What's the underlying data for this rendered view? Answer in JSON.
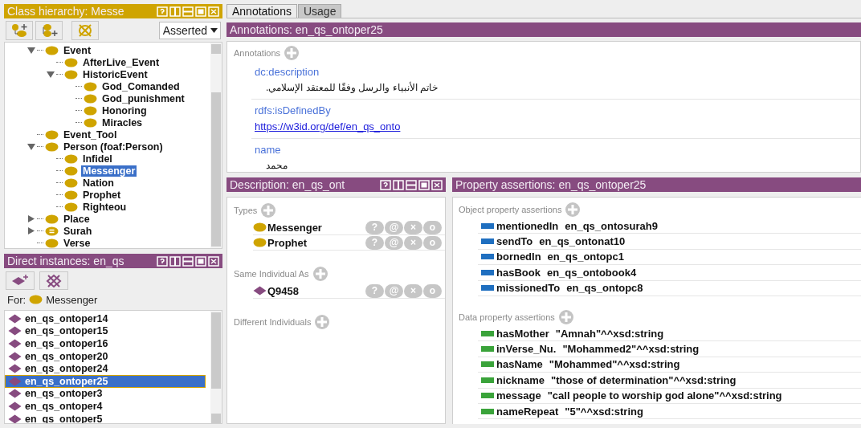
{
  "class_hierarchy": {
    "title": "Class hierarchy: Messe",
    "mode": "Asserted",
    "tree": [
      {
        "label": "Event",
        "kind": "class",
        "expanded": true,
        "selected": false,
        "children": [
          {
            "label": "AfterLive_Event",
            "kind": "class",
            "selected": false
          },
          {
            "label": "HistoricEvent",
            "kind": "class",
            "expanded": true,
            "selected": false,
            "children": [
              {
                "label": "God_Comanded",
                "kind": "class",
                "selected": false
              },
              {
                "label": "God_punishment",
                "kind": "class",
                "selected": false
              },
              {
                "label": "Honoring",
                "kind": "class",
                "selected": false
              },
              {
                "label": "Miracles",
                "kind": "class",
                "selected": false
              }
            ]
          }
        ]
      },
      {
        "label": "Event_Tool",
        "kind": "class",
        "selected": false
      },
      {
        "label": "Person (foaf:Person)",
        "kind": "class",
        "expanded": true,
        "selected": false,
        "children": [
          {
            "label": "Infidel",
            "kind": "class",
            "selected": false
          },
          {
            "label": "Messenger",
            "kind": "class",
            "selected": true
          },
          {
            "label": "Nation",
            "kind": "class",
            "selected": false
          },
          {
            "label": "Prophet",
            "kind": "class",
            "selected": false
          },
          {
            "label": "Righteou",
            "kind": "class",
            "selected": false
          }
        ]
      },
      {
        "label": "Place",
        "kind": "class",
        "expanded": false,
        "selected": false
      },
      {
        "label": "Surah",
        "kind": "defined",
        "expanded": false,
        "selected": false
      },
      {
        "label": "Verse",
        "kind": "class",
        "selected": false
      }
    ]
  },
  "direct_instances": {
    "title": "Direct instances: en_qs",
    "for_label": "For:",
    "for_class": "Messenger",
    "items": [
      {
        "label": "en_qs_ontoper14",
        "selected": false
      },
      {
        "label": "en_qs_ontoper15",
        "selected": false
      },
      {
        "label": "en_qs_ontoper16",
        "selected": false
      },
      {
        "label": "en_qs_ontoper20",
        "selected": false
      },
      {
        "label": "en_qs_ontoper24",
        "selected": false
      },
      {
        "label": "en_qs_ontoper25",
        "selected": true
      },
      {
        "label": "en_qs_ontoper3",
        "selected": false
      },
      {
        "label": "en_qs_ontoper4",
        "selected": false
      },
      {
        "label": "en_qs_ontoper5",
        "selected": false
      }
    ]
  },
  "tabs": [
    {
      "label": "Annotations",
      "selected": true
    },
    {
      "label": "Usage",
      "selected": false
    }
  ],
  "annotations": {
    "title": "Annotations: en_qs_ontoper25",
    "section": "Annotations",
    "entries": [
      {
        "property": "dc:description",
        "value": "خاتم الأنبياء والرسل وفقًا للمعتقد الإسلامي.",
        "kind": "text"
      },
      {
        "property": "rdfs:isDefinedBy",
        "value": "https://w3id.org/def/en_qs_onto",
        "kind": "link"
      },
      {
        "property": "name",
        "value": "محمد",
        "kind": "text"
      }
    ]
  },
  "description": {
    "title": "Description: en_qs_ont",
    "sections": [
      {
        "label": "Types",
        "items": [
          {
            "label": "Messenger",
            "kind": "class",
            "buttons": [
              "?",
              "@",
              "×",
              "o"
            ]
          },
          {
            "label": "Prophet",
            "kind": "class",
            "buttons": [
              "?",
              "@",
              "×",
              "o"
            ]
          }
        ]
      },
      {
        "label": "Same Individual As",
        "items": [
          {
            "label": "Q9458",
            "kind": "individual",
            "buttons": [
              "?",
              "@",
              "×",
              "o"
            ]
          }
        ]
      },
      {
        "label": "Different Individuals"
      }
    ]
  },
  "property_assertions": {
    "title": "Property assertions: en_qs_ontoper25",
    "sections": [
      {
        "label": "Object property assertions",
        "kind": "object",
        "items": [
          {
            "property": "mentionedIn",
            "value": "en_qs_ontosurah9"
          },
          {
            "property": "sendTo",
            "value": "en_qs_ontonat10"
          },
          {
            "property": "bornedIn",
            "value": "en_qs_ontopc1"
          },
          {
            "property": "hasBook",
            "value": "en_qs_ontobook4"
          },
          {
            "property": "missionedTo",
            "value": "en_qs_ontopc8"
          }
        ]
      },
      {
        "label": "Data property assertions",
        "kind": "data",
        "items": [
          {
            "property": "hasMother",
            "value": "\"Amnah\"^^xsd:string"
          },
          {
            "property": "inVerse_Nu.",
            "value": "\"Mohammed2\"^^xsd:string"
          },
          {
            "property": "hasName",
            "value": "\"Mohammed\"^^xsd:string"
          },
          {
            "property": "nickname",
            "value": "\"those of determination\"^^xsd:string"
          },
          {
            "property": "message",
            "value": "\"call people to worship god alone\"^^xsd:string"
          },
          {
            "property": "nameRepeat",
            "value": "\"5\"^^xsd:string"
          }
        ]
      }
    ]
  }
}
